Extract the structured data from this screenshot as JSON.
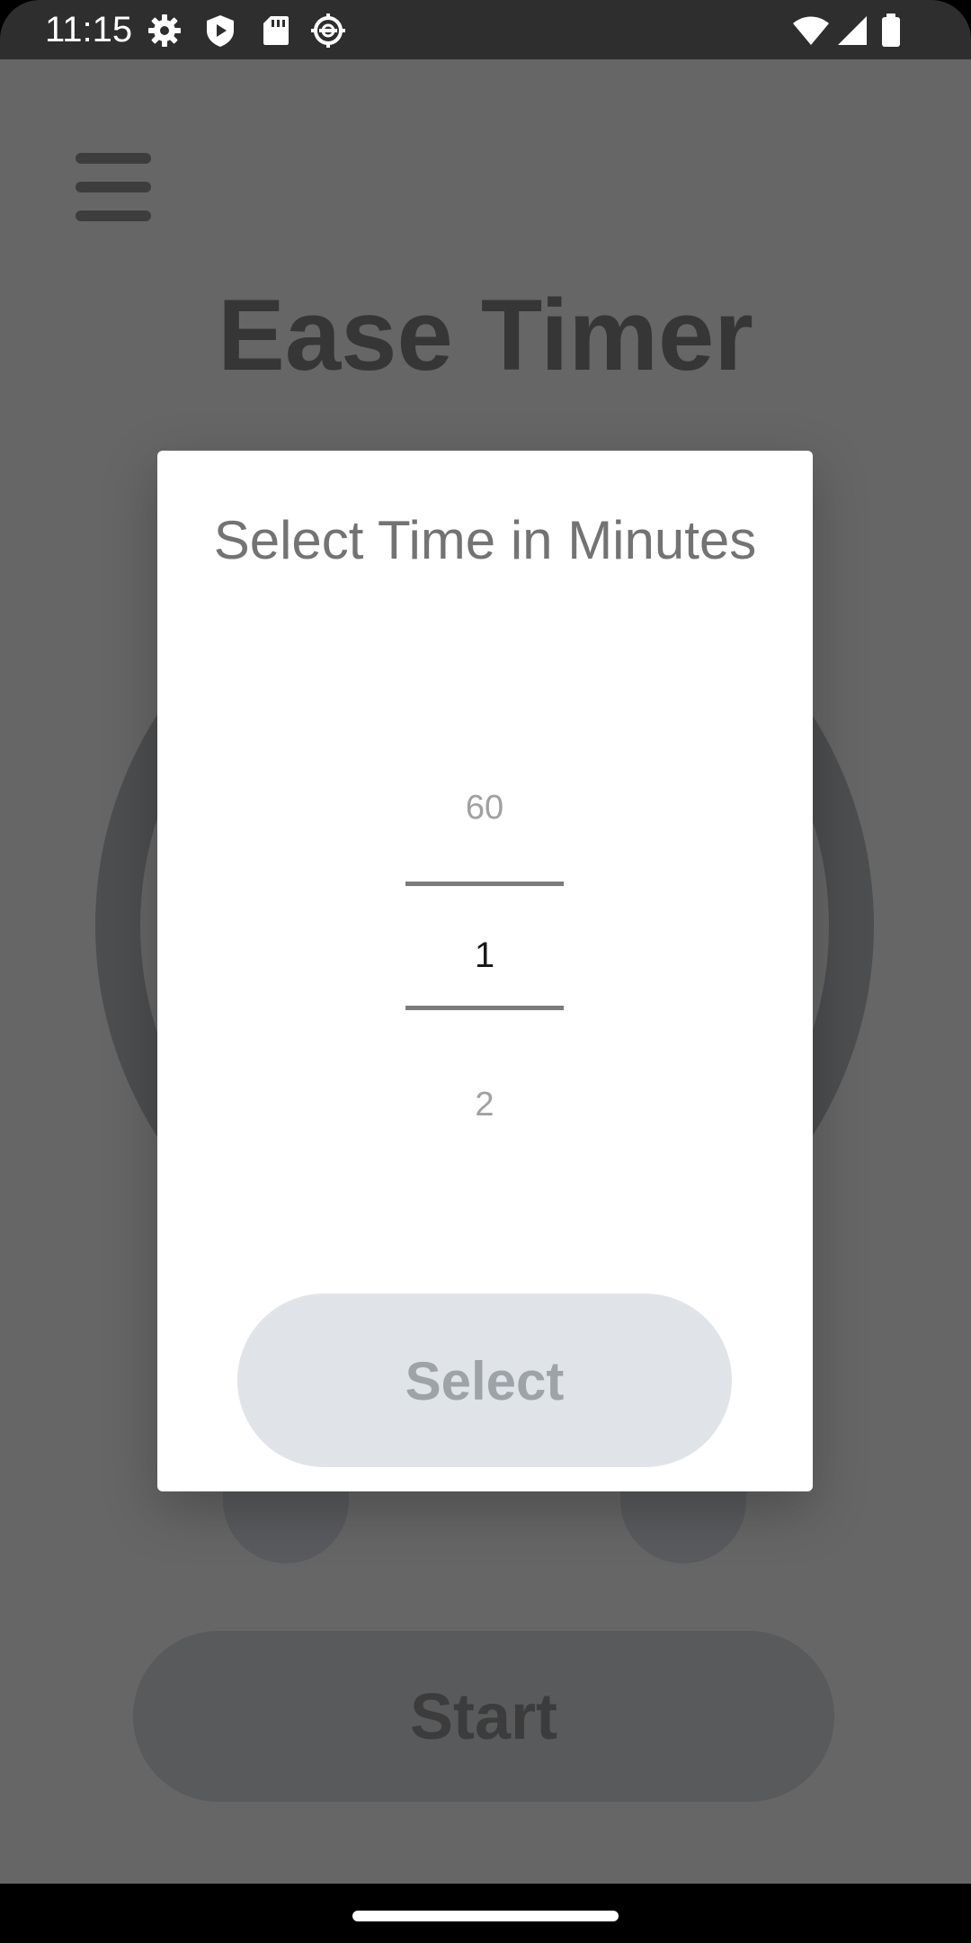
{
  "status_bar": {
    "time": "11:15",
    "left_icons": [
      "settings-icon",
      "shield-play-icon",
      "sd-card-icon",
      "gear-badge-icon"
    ],
    "right_icons": [
      "wifi-icon",
      "cell-signal-icon",
      "battery-icon"
    ]
  },
  "app": {
    "title": "Ease Timer",
    "menu_icon": "hamburger-menu-icon",
    "start_label": "Start"
  },
  "dialog": {
    "title": "Select Time in Minutes",
    "picker": {
      "previous": "60",
      "current": "1",
      "next": "2"
    },
    "select_label": "Select"
  },
  "colors": {
    "scrim": "#666666",
    "dialog_bg": "#ffffff",
    "select_button_bg": "#e0e4e8",
    "select_button_text": "#9ea3a8",
    "status_bar_bg": "#2e2e2e"
  }
}
